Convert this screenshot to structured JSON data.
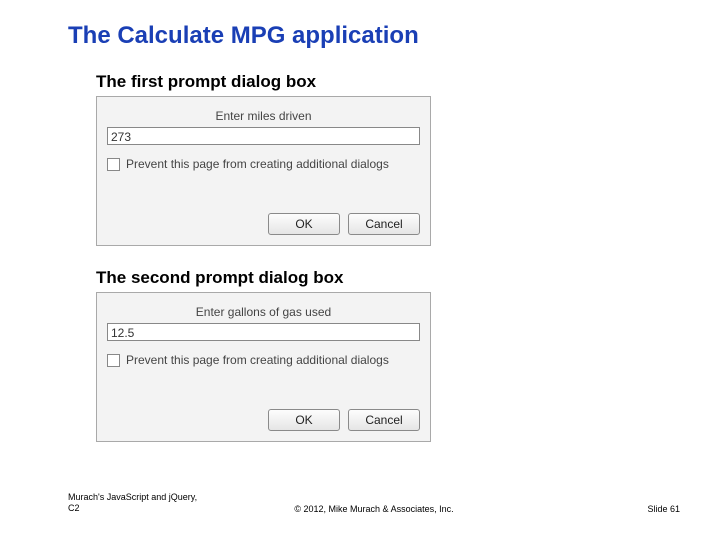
{
  "title": "The Calculate MPG application",
  "section1": {
    "heading": "The first prompt dialog box"
  },
  "section2": {
    "heading": "The second prompt dialog box"
  },
  "dialog1": {
    "prompt": "Enter miles driven",
    "value": "273",
    "prevent_label": "Prevent this page from creating additional dialogs",
    "ok": "OK",
    "cancel": "Cancel"
  },
  "dialog2": {
    "prompt": "Enter gallons of gas used",
    "value": "12.5",
    "prevent_label": "Prevent this page from creating additional dialogs",
    "ok": "OK",
    "cancel": "Cancel"
  },
  "footer": {
    "book_line1": "Murach's JavaScript and jQuery,",
    "book_line2": "C2",
    "copyright": "© 2012, Mike Murach & Associates, Inc.",
    "slide": "Slide 61"
  }
}
